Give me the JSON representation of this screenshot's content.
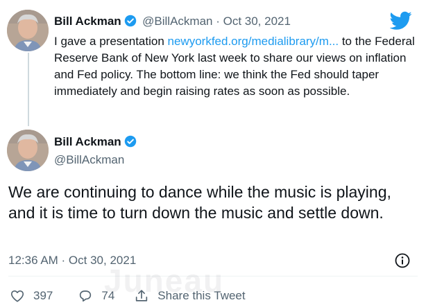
{
  "reply_to": {
    "name": "Bill Ackman",
    "handle": "@BillAckman",
    "separator": " · ",
    "date": "Oct 30, 2021",
    "text_before_link": "I gave a presentation ",
    "link_text": "newyorkfed.org/medialibrary/m...",
    "text_after_link": " to the Federal Reserve Bank of New York last week to share our views on inflation and Fed policy. The bottom line: we think the Fed should taper immediately and begin raising rates as soon as possible."
  },
  "tweet": {
    "name": "Bill Ackman",
    "handle": "@BillAckman",
    "text": "We are continuing to dance while the music is playing, and it is time to turn down the music and settle down.",
    "timestamp": "12:36 AM · Oct 30, 2021"
  },
  "actions": {
    "likes": "397",
    "replies": "74",
    "share_label": "Share this Tweet"
  },
  "watermark": "Juneau",
  "colors": {
    "accent": "#1d9bf0",
    "text": "#0f1419",
    "muted": "#536471"
  }
}
